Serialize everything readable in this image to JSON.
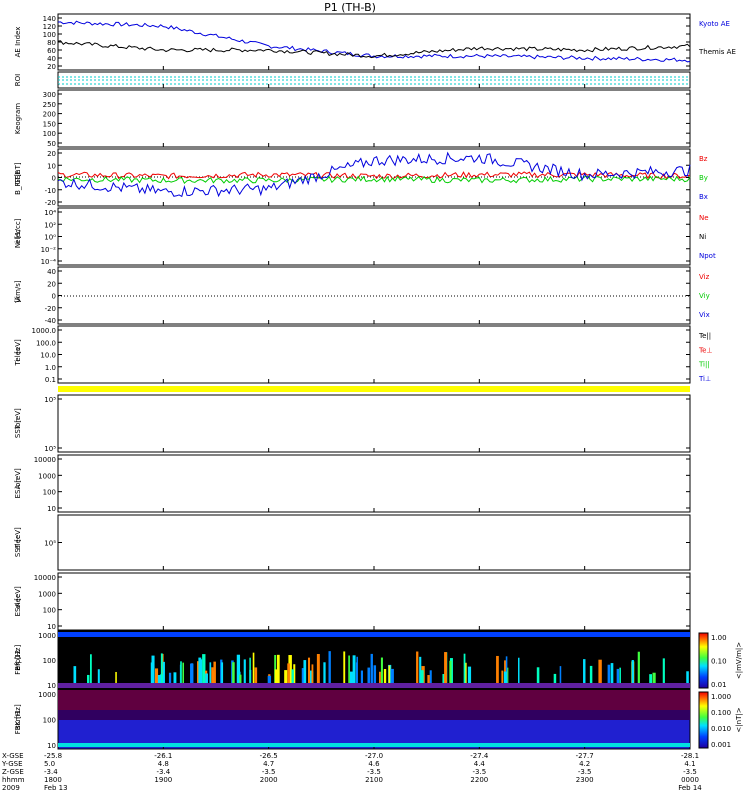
{
  "title": "P1 (TH-B)",
  "colors": {
    "blue": "#0000dd",
    "red": "#ee0000",
    "green": "#00cc00",
    "black": "#000000",
    "yellow": "#ffff00",
    "cyan": "#00cccc"
  },
  "panels": [
    {
      "id": "ae",
      "label": "AE Index",
      "yticks": [
        "140",
        "120",
        "100",
        "80",
        "60",
        "40",
        "20"
      ],
      "legend": [
        {
          "text": "Kyoto AE",
          "color": "#0000dd"
        },
        {
          "text": "Themis AE",
          "color": "#000000"
        }
      ]
    },
    {
      "id": "roi",
      "label": "ROI",
      "yticks": [],
      "legend": []
    },
    {
      "id": "keogram",
      "label": "Keogram",
      "yticks": [
        "300",
        "250",
        "200",
        "150",
        "100",
        "50"
      ],
      "legend": []
    },
    {
      "id": "bfit",
      "label": "B_FIT\nGSE\n[nT]",
      "yticks": [
        "20",
        "10",
        "0",
        "-10",
        "-20"
      ],
      "legend": [
        {
          "text": "Bz",
          "color": "#ee0000"
        },
        {
          "text": "By",
          "color": "#00cc00"
        },
        {
          "text": "Bx",
          "color": "#0000dd"
        }
      ]
    },
    {
      "id": "ni",
      "label": "Ni\nelec\n[1/cc]",
      "yticks": [
        "10⁴",
        "10²",
        "10⁰",
        "10⁻²",
        "10⁻⁴"
      ],
      "legend": [
        {
          "text": "Ne",
          "color": "#ee0000"
        },
        {
          "text": "Ni",
          "color": "#000000"
        },
        {
          "text": "Npot",
          "color": "#0000dd"
        }
      ]
    },
    {
      "id": "vi",
      "label": "Vi\n[km/s]",
      "yticks": [
        "40",
        "20",
        "0",
        "-20",
        "-40"
      ],
      "legend": [
        {
          "text": "Viz",
          "color": "#ee0000"
        },
        {
          "text": "Viy",
          "color": "#00cc00"
        },
        {
          "text": "Vix",
          "color": "#0000dd"
        }
      ]
    },
    {
      "id": "ti",
      "label": "Ti\neles\n[eV]",
      "yticks": [
        "1000.0",
        "100.0",
        "10.0",
        "1.0",
        "0.1"
      ],
      "legend": [
        {
          "text": "Te||",
          "color": "#000000"
        },
        {
          "text": "Te⊥",
          "color": "#ee0000"
        },
        {
          "text": "Ti||",
          "color": "#00cc00"
        },
        {
          "text": "Ti⊥",
          "color": "#0000dd"
        }
      ]
    },
    {
      "id": "sst1",
      "label": "SST\nion\n[eV]",
      "yticks": [
        "10⁵",
        "10⁵"
      ],
      "legend": []
    },
    {
      "id": "esa1",
      "label": "ESA\nion\n[eV]",
      "yticks": [
        "10000",
        "1000",
        "100",
        "10"
      ],
      "legend": []
    },
    {
      "id": "sst2",
      "label": "SST\nelec\n[eV]",
      "yticks": [
        "10⁵"
      ],
      "legend": []
    },
    {
      "id": "esa2",
      "label": "ESA\nelec\n[eV]",
      "yticks": [
        "10000",
        "1000",
        "100",
        "10"
      ],
      "legend": []
    },
    {
      "id": "fbk1",
      "label": "FBK\nefp12\n[Hz]",
      "yticks": [
        "1000",
        "100",
        "10"
      ],
      "legend": []
    },
    {
      "id": "fbk2",
      "label": "FBK\nscm1\n[Hz]",
      "yticks": [
        "1000",
        "100",
        "10"
      ],
      "legend": []
    }
  ],
  "colorbars": [
    {
      "id": "cb1",
      "unit": "<|mV/m|>",
      "ticks": [
        "1.00",
        "0.10",
        "0.01"
      ]
    },
    {
      "id": "cb2",
      "unit": "<|nT|>",
      "ticks": [
        "1.000",
        "0.100",
        "0.010",
        "0.001"
      ]
    }
  ],
  "xaxis": {
    "row_labels": [
      "X-GSE",
      "Y-GSE",
      "Z-GSE",
      "hhmm",
      "2009"
    ],
    "columns": [
      {
        "vals": [
          "-25.8",
          "5.0",
          "-3.4",
          "1800",
          "Feb 13"
        ]
      },
      {
        "vals": [
          "-26.1",
          "4.8",
          "-3.4",
          "1900",
          ""
        ]
      },
      {
        "vals": [
          "-26.5",
          "4.7",
          "-3.5",
          "2000",
          ""
        ]
      },
      {
        "vals": [
          "-27.0",
          "4.6",
          "-3.5",
          "2100",
          ""
        ]
      },
      {
        "vals": [
          "-27.4",
          "4.4",
          "-3.5",
          "2200",
          ""
        ]
      },
      {
        "vals": [
          "-27.7",
          "4.2",
          "-3.5",
          "2300",
          ""
        ]
      },
      {
        "vals": [
          "-28.1",
          "4.1",
          "-3.5",
          "0000",
          "Feb 14"
        ]
      }
    ]
  },
  "chart_data": {
    "type": "line",
    "title": "P1 (TH-B)",
    "x": [
      "1800",
      "1900",
      "2000",
      "2100",
      "2200",
      "2300",
      "0000"
    ],
    "series": [
      {
        "name": "Kyoto AE",
        "panel": "ae",
        "values": [
          120,
          110,
          60,
          35,
          35,
          30,
          25
        ]
      },
      {
        "name": "Themis AE",
        "panel": "ae",
        "values": [
          70,
          50,
          50,
          35,
          55,
          50,
          60
        ]
      },
      {
        "name": "Bz",
        "panel": "bfit",
        "values": [
          2,
          1,
          2,
          1,
          2,
          2,
          1
        ]
      },
      {
        "name": "By",
        "panel": "bfit",
        "values": [
          -1,
          -2,
          -2,
          -1,
          -2,
          -1,
          -1
        ]
      },
      {
        "name": "Bx",
        "panel": "bfit",
        "values": [
          -3,
          -10,
          -8,
          12,
          14,
          2,
          5
        ]
      }
    ],
    "xlabel": "hhmm",
    "ylim": [
      [
        0,
        140
      ],
      [
        -20,
        20
      ]
    ]
  }
}
